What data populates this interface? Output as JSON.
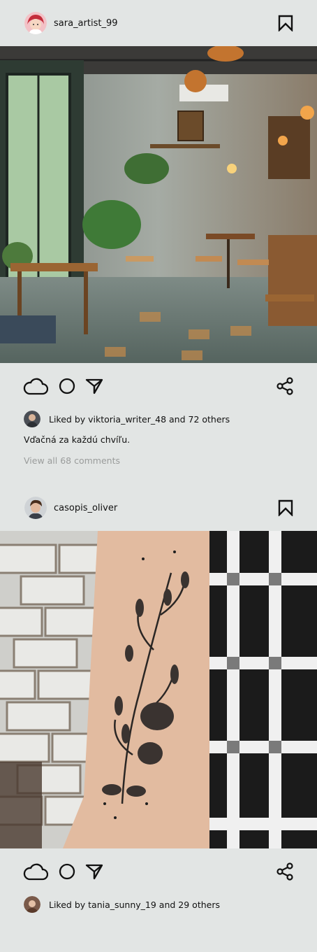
{
  "posts": [
    {
      "username": "sara_artist_99",
      "liked_by_user": "viktoria_writer_48",
      "likes_text": "Liked by viktoria_writer_48 and 72 others",
      "caption": "Vďačná za každú chvíľu.",
      "comments_text": "View all 68 comments",
      "photo_subject": "cafe interior with wooden tables, plants and pendant lamps"
    },
    {
      "username": "casopis_oliver",
      "liked_by_user": "tania_sunny_19",
      "likes_text": "Liked by tania_sunny_19 and 29 others",
      "photo_subject": "forearm floral tattoo against white brick wall and plaid shirt"
    }
  ],
  "icons": {
    "like": "cloud-icon",
    "comment": "circle-icon",
    "share": "send-icon",
    "reshare": "share-nodes-icon",
    "save": "bookmark-icon"
  },
  "colors": {
    "background": "#e2e5e4",
    "text": "#111111",
    "muted": "#9a9c9b"
  }
}
